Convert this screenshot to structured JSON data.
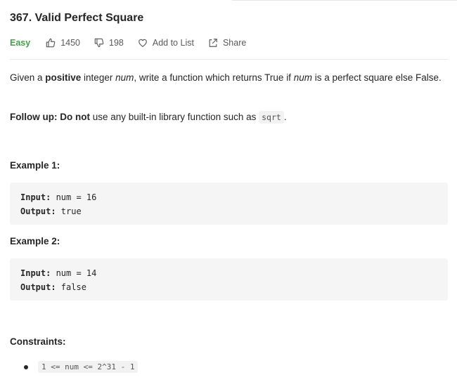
{
  "problem": {
    "title": "367. Valid Perfect Square",
    "difficulty": "Easy",
    "likes": "1450",
    "dislikes": "198",
    "add_to_list_label": "Add to List",
    "share_label": "Share",
    "difficulty_color": "#43a047"
  },
  "description": {
    "p1_a": "Given a ",
    "p1_b": "positive",
    "p1_c": " integer ",
    "p1_d": "num",
    "p1_e": ", write a function which returns True if ",
    "p1_f": "num",
    "p1_g": " is a perfect square else False.",
    "followup_label": "Follow up:",
    "followup_donot": "Do not",
    "followup_text": " use any built-in library function such as ",
    "followup_code": "sqrt",
    "followup_end": "."
  },
  "examples": [
    {
      "title": "Example 1:",
      "input_label": "Input:",
      "input_value": " num = 16",
      "output_label": "Output:",
      "output_value": " true"
    },
    {
      "title": "Example 2:",
      "input_label": "Input:",
      "input_value": " num = 14",
      "output_label": "Output:",
      "output_value": " false"
    }
  ],
  "constraints": {
    "title": "Constraints:",
    "items": [
      "1 <= num <= 2^31 - 1"
    ]
  },
  "icons": {
    "like": "thumbs-up-icon",
    "dislike": "thumbs-down-icon",
    "add_to_list": "heart-icon",
    "share": "share-icon"
  }
}
